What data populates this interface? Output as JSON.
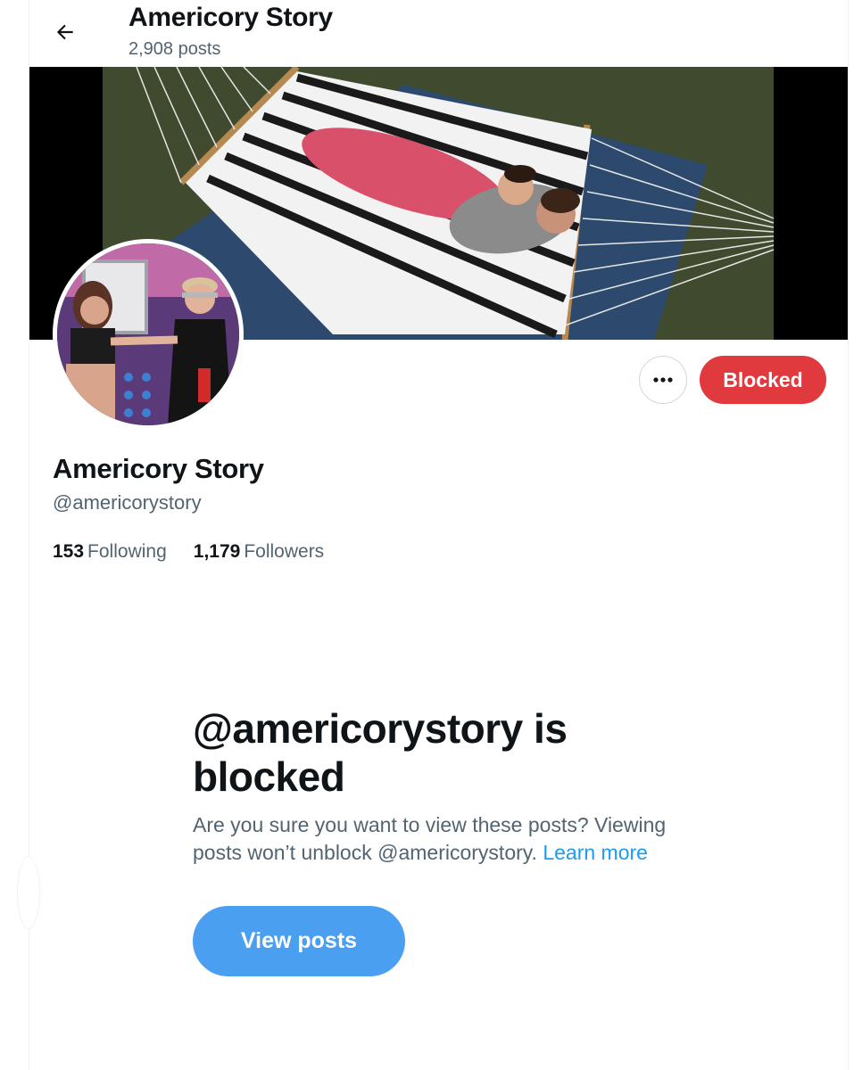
{
  "header": {
    "title": "Americory Story",
    "post_count": "2,908 posts"
  },
  "profile": {
    "display_name": "Americory Story",
    "handle": "@americorystory",
    "following_count": "153",
    "following_label": "Following",
    "followers_count": "1,179",
    "followers_label": "Followers"
  },
  "actions": {
    "more_icon": "more-dots-icon",
    "blocked_label": "Blocked"
  },
  "blocked_notice": {
    "title": "@americorystory is blocked",
    "description": "Are you sure you want to view these posts? Viewing posts won’t unblock @americorystory.",
    "learn_more": "Learn more",
    "view_posts_label": "View posts"
  },
  "colors": {
    "blocked_red": "#e0393e",
    "view_posts_blue": "#4b9ff0",
    "link_blue": "#1d9bf0",
    "secondary_text": "#536471"
  }
}
